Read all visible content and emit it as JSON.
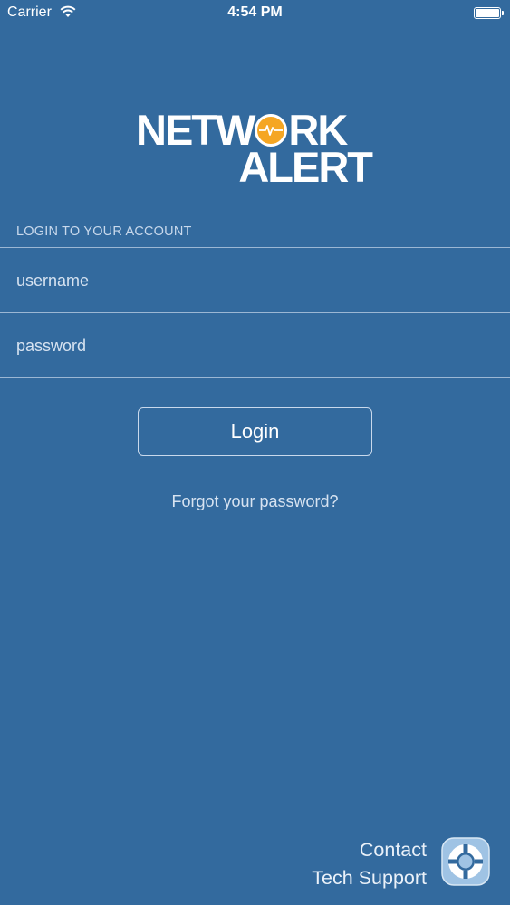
{
  "status_bar": {
    "carrier": "Carrier",
    "time": "4:54 PM"
  },
  "logo": {
    "line1_pre": "NETW",
    "line1_post": "RK",
    "line2": "ALERT",
    "accent_color": "#f5a623"
  },
  "login_form": {
    "section_label": "LOGIN TO YOUR ACCOUNT",
    "username_placeholder": "username",
    "username_value": "",
    "password_placeholder": "password",
    "password_value": "",
    "login_button": "Login",
    "forgot_link": "Forgot your password?"
  },
  "support": {
    "line1": "Contact",
    "line2": "Tech Support",
    "icon": "lifebuoy-icon"
  },
  "colors": {
    "background": "#336a9e",
    "divider": "#9cb7d4"
  }
}
